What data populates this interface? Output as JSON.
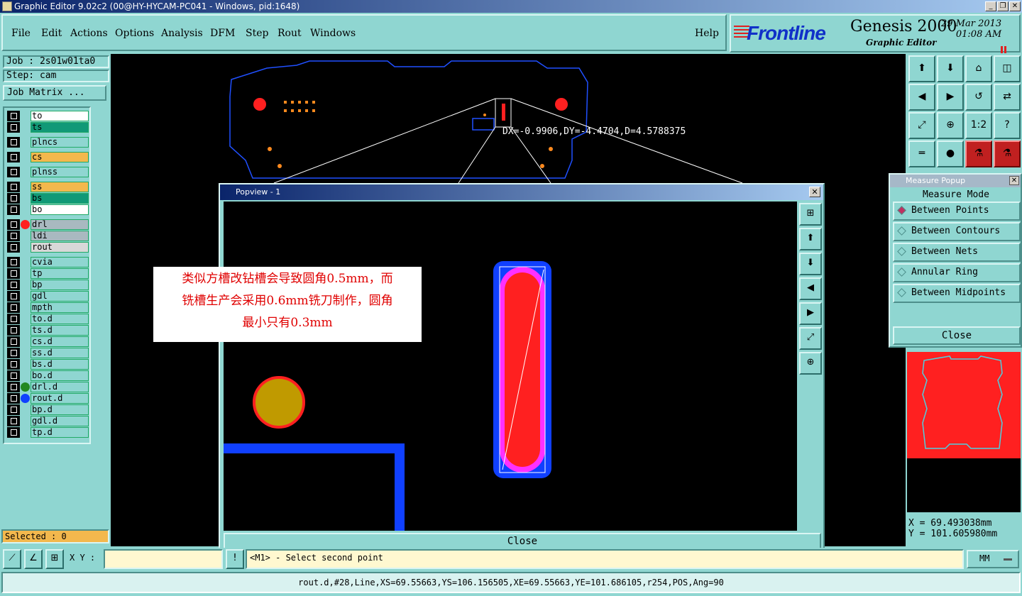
{
  "window": {
    "title": "Graphic Editor 9.02c2 (00@HY-HYCAM-PC041 - Windows, pid:1648)",
    "controls": [
      "_",
      "❐",
      "✕"
    ]
  },
  "menu": [
    "File",
    "Edit",
    "Actions",
    "Options",
    "Analysis",
    "DFM",
    "Step",
    "Rout",
    "Windows"
  ],
  "help_label": "Help",
  "brand": {
    "logo": "Frontline",
    "product": "Genesis 2000",
    "subtitle": "Graphic Editor",
    "date": "29 Mar 2013",
    "time": "01:08 AM"
  },
  "job": {
    "job_label": "Job : 2s01w01ta0",
    "step_label": "Step: cam",
    "matrix_button": "Job Matrix ..."
  },
  "layers": [
    {
      "name": "to",
      "color": "#ffffff",
      "dot": ""
    },
    {
      "name": "ts",
      "color": "#119977",
      "dot": ""
    },
    {
      "name": "plncs",
      "color": "#8fd6d1",
      "dot": ""
    },
    {
      "name": "cs",
      "color": "#f3b84d",
      "dot": ""
    },
    {
      "name": "plnss",
      "color": "#8fd6d1",
      "dot": ""
    },
    {
      "name": "ss",
      "color": "#f3b84d",
      "dot": ""
    },
    {
      "name": "bs",
      "color": "#119977",
      "dot": ""
    },
    {
      "name": "bo",
      "color": "#ffffff",
      "dot": ""
    },
    {
      "name": "drl",
      "color": "#a9b9c0",
      "dot": "#ff2020"
    },
    {
      "name": "ldi",
      "color": "#a9b9c0",
      "dot": ""
    },
    {
      "name": "rout",
      "color": "#d8d8d8",
      "dot": ""
    },
    {
      "name": "cvia",
      "color": "#8fd6d1",
      "dot": ""
    },
    {
      "name": "tp",
      "color": "#8fd6d1",
      "dot": ""
    },
    {
      "name": "bp",
      "color": "#8fd6d1",
      "dot": ""
    },
    {
      "name": "gdl",
      "color": "#8fd6d1",
      "dot": ""
    },
    {
      "name": "mpth",
      "color": "#8fd6d1",
      "dot": ""
    },
    {
      "name": "to.d",
      "color": "#8fd6d1",
      "dot": ""
    },
    {
      "name": "ts.d",
      "color": "#8fd6d1",
      "dot": ""
    },
    {
      "name": "cs.d",
      "color": "#8fd6d1",
      "dot": ""
    },
    {
      "name": "ss.d",
      "color": "#8fd6d1",
      "dot": ""
    },
    {
      "name": "bs.d",
      "color": "#8fd6d1",
      "dot": ""
    },
    {
      "name": "bo.d",
      "color": "#8fd6d1",
      "dot": ""
    },
    {
      "name": "drl.d",
      "color": "#8fd6d1",
      "dot": "#228822"
    },
    {
      "name": "rout.d",
      "color": "#8fd6d1",
      "dot": "#1040ff"
    },
    {
      "name": "bp.d",
      "color": "#8fd6d1",
      "dot": ""
    },
    {
      "name": "gdl.d",
      "color": "#8fd6d1",
      "dot": ""
    },
    {
      "name": "tp.d",
      "color": "#8fd6d1",
      "dot": ""
    }
  ],
  "selected_label": "Selected : 0",
  "measure_readout": "DX=-0.9906,DY=-4.4704,D=4.5788375",
  "tool_icons": [
    "zoom-home-icon",
    "zoom-step-icon",
    "home-icon",
    "window-icon",
    "pan-left-icon",
    "pan-right-icon",
    "undo-icon",
    "flip-icon",
    "fit-icon",
    "center-icon",
    "scale-icon",
    "help-icon",
    "ruler-icon",
    "snap-icon",
    "layer-net-icon",
    "layer-red-icon"
  ],
  "tool_glyphs": [
    "⬆",
    "⬇",
    "⌂",
    "◫",
    "◀",
    "▶",
    "↺",
    "⇄",
    "⤢",
    "⊕",
    "1:2",
    "?",
    "═",
    "●",
    "⚗",
    "⚗"
  ],
  "measure_popup": {
    "title": "Measure Popup",
    "mode_label": "Measure Mode",
    "options": [
      "Between Points",
      "Between Contours",
      "Between Nets",
      "Annular Ring",
      "Between Midpoints"
    ],
    "selected_index": 0,
    "close_label": "Close"
  },
  "cursor": {
    "x_label": "X = 69.493038mm",
    "y_label": "Y = 101.605980mm"
  },
  "popview": {
    "title": "Popview - 1",
    "close_label": "Close",
    "side_glyphs": [
      "⊞",
      "⬆",
      "⬇",
      "◀",
      "▶",
      "⤢",
      "⊕"
    ]
  },
  "annotation": {
    "line1": "类似方槽改钻槽会导致圆角0.5mm，而",
    "line2": "铣槽生产会采用0.6mm铣刀制作，圆角",
    "line3": "最小只有0.3mm"
  },
  "bottom": {
    "xy_label": "X Y :",
    "message": "<M1> - Select second point",
    "units": "MM"
  },
  "status_line": "rout.d,#28,Line,XS=69.55663,YS=106.156505,XE=69.55663,YE=101.686105,r254,POS,Ang=90"
}
